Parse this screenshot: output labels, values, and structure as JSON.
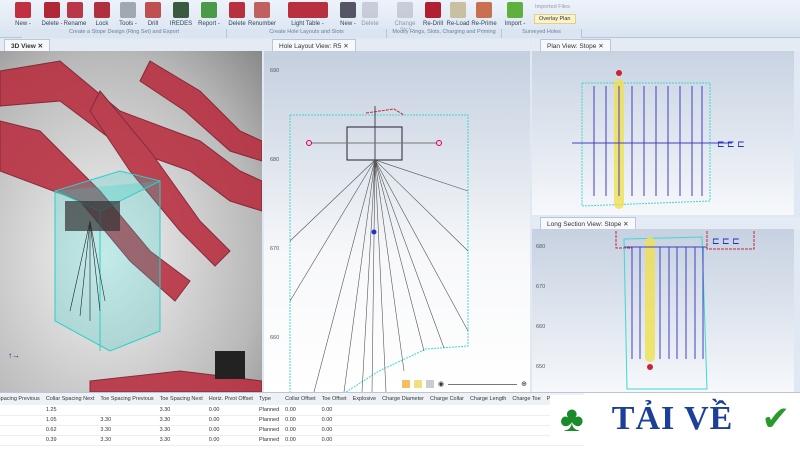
{
  "ribbon": {
    "buttons": [
      "New -",
      "Delete -",
      "Rename",
      "Lock",
      "Tools -",
      "Drill",
      "IREDES",
      "Report -",
      "Delete",
      "Renumber",
      "Light Table -",
      "New -",
      "Delete",
      "Change Slot",
      "Re-Drill",
      "Re-Load",
      "Re-Prime",
      "Import -"
    ],
    "side_items": [
      "Imported Files",
      "Overlay Plan"
    ],
    "groups": [
      "Create a Stope Design (Ring Set) and Export",
      "Create Hole Layouts and Slots",
      "Modify Rings, Slots, Charging and Priming",
      "Surveyed Holes"
    ]
  },
  "tabs": {
    "view3d": "3D View",
    "hole_layout": "Hole Layout View: R5",
    "plan": "Plan View: Stope",
    "long_section": "Long Section View: Stope"
  },
  "hole_layout_axis": [
    "690",
    "680",
    "670",
    "660"
  ],
  "long_section_axis": [
    "680",
    "670",
    "660",
    "650"
  ],
  "table": {
    "columns": [
      "Spacing Previous",
      "Collar Spacing Next",
      "Toe Spacing Previous",
      "Toe Spacing Next",
      "Horiz. Pivot Offset",
      "Type",
      "Collar Offset",
      "Toe Offset",
      "Explosive",
      "Charge Diameter",
      "Charge Collar",
      "Charge Length",
      "Charge Toe",
      "Primer",
      "Blast"
    ],
    "rows": [
      [
        "",
        "1.25",
        "",
        "3.30",
        "0.00",
        "Planned",
        "0.00",
        "0.00",
        "",
        "",
        "",
        "",
        "",
        "",
        ""
      ],
      [
        "",
        "1.05",
        "3.30",
        "3.30",
        "0.00",
        "Planned",
        "0.00",
        "0.00",
        "",
        "",
        "",
        "",
        "",
        "",
        ""
      ],
      [
        "",
        "0.62",
        "3.30",
        "3.30",
        "0.00",
        "Planned",
        "0.00",
        "0.00",
        "",
        "",
        "",
        "",
        "",
        "",
        ""
      ],
      [
        "",
        "0.39",
        "3.30",
        "3.30",
        "0.00",
        "Planned",
        "0.00",
        "0.00",
        "",
        "",
        "",
        "",
        "",
        "",
        ""
      ]
    ]
  },
  "watermark": {
    "text": "TẢI VỀ"
  },
  "colors": {
    "ore": "#c8283a",
    "outline": "#3fd8d0",
    "hole": "#3a3ac0",
    "highlight": "#f0e050"
  }
}
